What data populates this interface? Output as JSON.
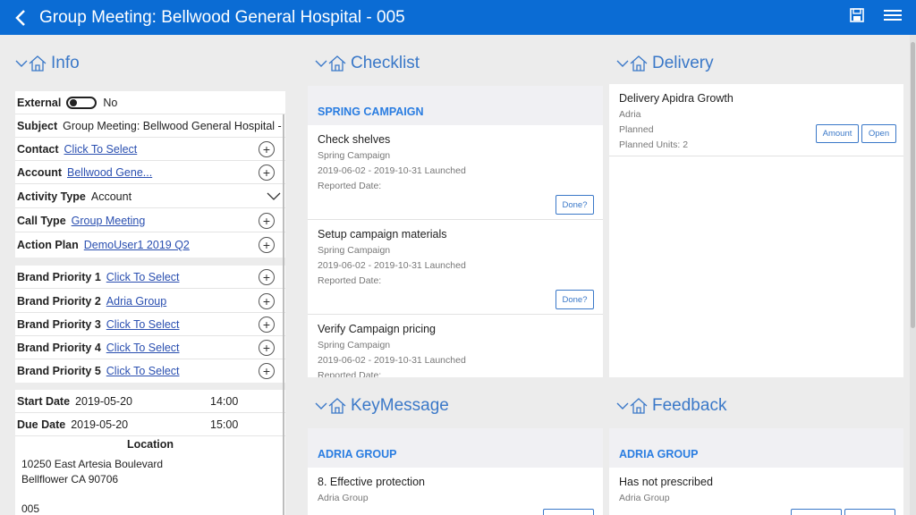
{
  "header": {
    "title": "Group Meeting: Bellwood General Hospital - 005"
  },
  "sections": {
    "info": "Info",
    "checklist": "Checklist",
    "delivery": "Delivery",
    "keymessage": "KeyMessage",
    "feedback": "Feedback"
  },
  "info": {
    "external_label": "External",
    "external_value": "No",
    "subject_label": "Subject",
    "subject_value": "Group Meeting: Bellwood General Hospital -",
    "contact_label": "Contact",
    "contact_value": "Click To Select",
    "account_label": "Account",
    "account_value": "Bellwood Gene...",
    "activity_type_label": "Activity Type",
    "activity_type_value": "Account",
    "call_type_label": "Call Type",
    "call_type_value": "Group Meeting",
    "action_plan_label": "Action Plan",
    "action_plan_value": "DemoUser1 2019 Q2",
    "brand_priorities": [
      {
        "label": "Brand Priority 1",
        "value": "Click To Select"
      },
      {
        "label": "Brand Priority 2",
        "value": "Adria Group"
      },
      {
        "label": "Brand Priority 3",
        "value": "Click To Select"
      },
      {
        "label": "Brand Priority 4",
        "value": "Click To Select"
      },
      {
        "label": "Brand Priority 5",
        "value": "Click To Select"
      }
    ],
    "start_date_label": "Start Date",
    "start_date": "2019-05-20",
    "start_time": "14:00",
    "due_date_label": "Due Date",
    "due_date": "2019-05-20",
    "due_time": "15:00",
    "location_label": "Location",
    "location_line1": "10250 East Artesia Boulevard",
    "location_line2": "Bellflower CA 90706",
    "footer_value": "005"
  },
  "checklist": {
    "group": "SPRING CAMPAIGN",
    "items": [
      {
        "title": "Check shelves",
        "campaign": "Spring Campaign",
        "dates": "2019-06-02 - 2019-10-31 Launched",
        "reported": "Reported Date:",
        "button": "Done?"
      },
      {
        "title": "Setup campaign materials",
        "campaign": "Spring Campaign",
        "dates": "2019-06-02 - 2019-10-31 Launched",
        "reported": "Reported Date:",
        "button": "Done?"
      },
      {
        "title": "Verify Campaign pricing",
        "campaign": "Spring Campaign",
        "dates": "2019-06-02 - 2019-10-31 Launched",
        "reported": "Reported Date:"
      }
    ]
  },
  "delivery": {
    "title": "Delivery Apidra Growth",
    "brand": "Adria",
    "status": "Planned",
    "units": "Planned Units: 2",
    "amount_button": "Amount",
    "open_button": "Open"
  },
  "keymessage": {
    "group": "ADRIA GROUP",
    "item_title": "8. Effective protection",
    "item_sub": "Adria Group"
  },
  "feedback": {
    "group": "ADRIA GROUP",
    "item_title": "Has not prescribed",
    "item_sub": "Adria Group"
  }
}
